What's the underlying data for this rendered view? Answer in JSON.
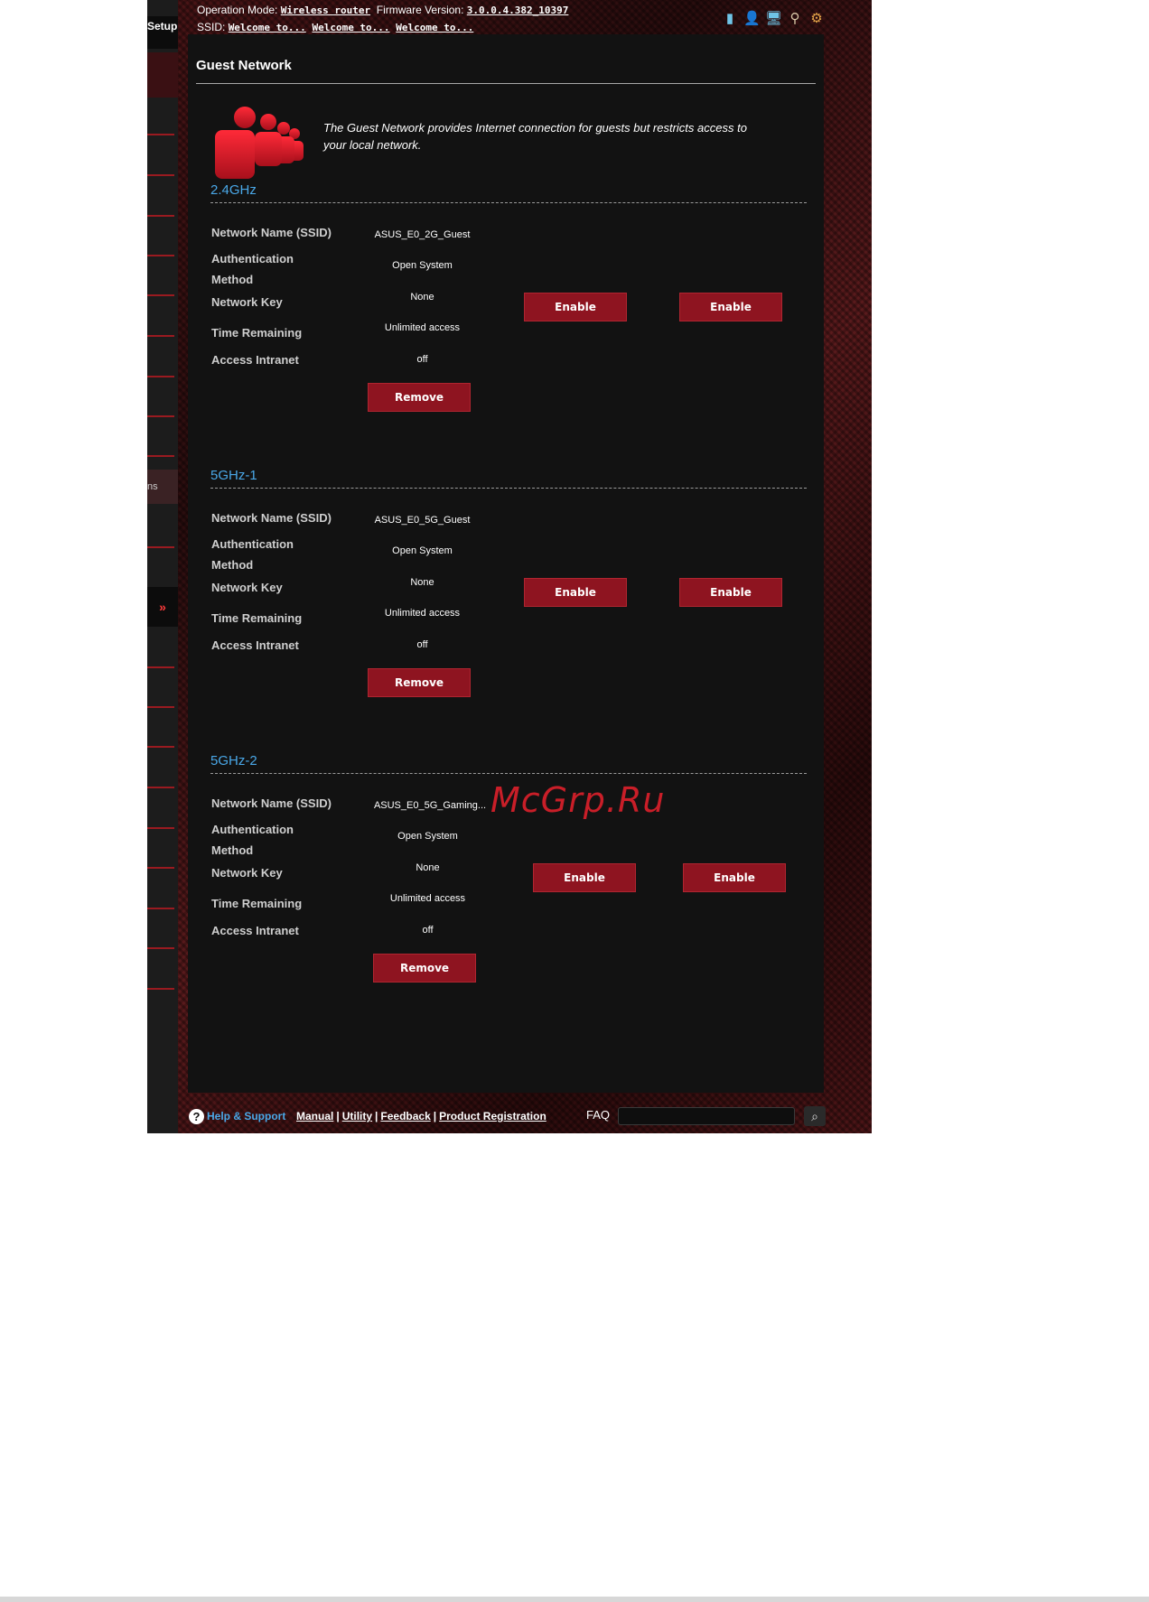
{
  "leftnav": {
    "setup_label": "Setup",
    "partial_item": "ns",
    "expand_glyph": "»"
  },
  "topbar": {
    "op_mode_label": "Operation Mode:",
    "op_mode_value": "Wireless router",
    "fw_label": "Firmware Version:",
    "fw_value": "3.0.0.4.382_10397",
    "ssid_label": "SSID:",
    "ssids": [
      "Welcome to...",
      "Welcome to...",
      "Welcome to..."
    ],
    "icons": [
      "sim-card-icon",
      "user-client-icon",
      "network-computers-icon",
      "usb-icon",
      "settings-icon"
    ]
  },
  "page": {
    "title": "Guest Network",
    "description": "The Guest Network provides Internet connection for guests but restricts access to your local network."
  },
  "labels": {
    "ssid": "Network Name (SSID)",
    "auth_line1": "Authentication",
    "auth_line2": "Method",
    "key": "Network Key",
    "time": "Time Remaining",
    "intranet": "Access Intranet"
  },
  "bands": [
    {
      "title": "2.4GHz",
      "ssid": "ASUS_E0_2G_Guest",
      "auth": "Open System",
      "key": "None",
      "time": "Unlimited access",
      "intranet": "off",
      "remove_label": "Remove",
      "enable_labels": [
        "Enable",
        "Enable"
      ]
    },
    {
      "title": "5GHz-1",
      "ssid": "ASUS_E0_5G_Guest",
      "auth": "Open System",
      "key": "None",
      "time": "Unlimited access",
      "intranet": "off",
      "remove_label": "Remove",
      "enable_labels": [
        "Enable",
        "Enable"
      ]
    },
    {
      "title": "5GHz-2",
      "ssid": "ASUS_E0_5G_Gaming...",
      "auth": "Open System",
      "key": "None",
      "time": "Unlimited access",
      "intranet": "off",
      "remove_label": "Remove",
      "enable_labels": [
        "Enable",
        "Enable"
      ]
    }
  ],
  "footer": {
    "help_label": "Help & Support",
    "links": [
      "Manual",
      "Utility",
      "Feedback",
      "Product Registration"
    ],
    "faq_label": "FAQ"
  },
  "watermark": "McGrp.Ru",
  "colors": {
    "accent_blue": "#4aa8e8",
    "button_red": "#8e1420",
    "panel_bg": "#121212"
  }
}
